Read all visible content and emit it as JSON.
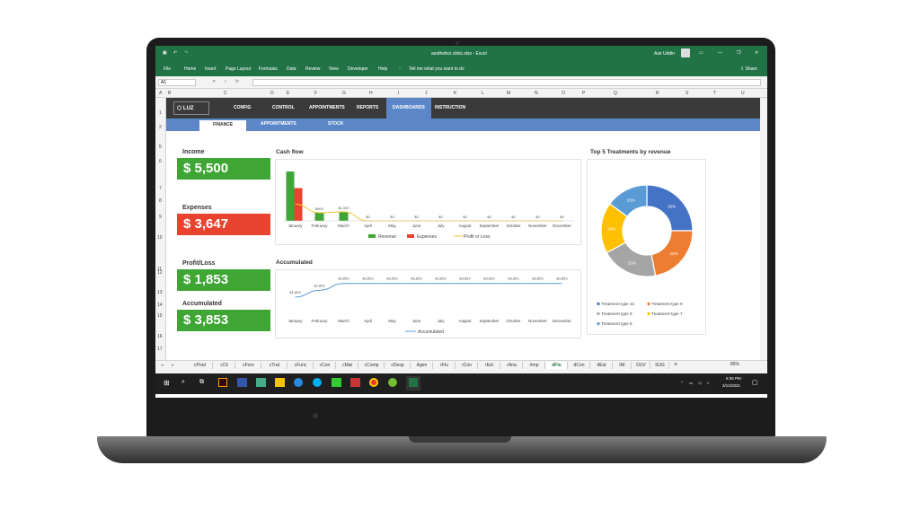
{
  "window": {
    "title": "aesthetics clinic.xlsx - Excel",
    "user": "Asir Uddin"
  },
  "menu": [
    "File",
    "Home",
    "Insert",
    "Page Layout",
    "Formulas",
    "Data",
    "Review",
    "View",
    "Developer",
    "Help"
  ],
  "tell_me": "Tell me what you want to do",
  "share": "Share",
  "name_box": "A1",
  "columns": [
    "A",
    "B",
    "C",
    "D",
    "E",
    "F",
    "G",
    "H",
    "I",
    "J",
    "K",
    "L",
    "M",
    "N",
    "O",
    "P",
    "Q",
    "R",
    "S",
    "T",
    "U"
  ],
  "rows": [
    "1",
    "2",
    "5",
    "6",
    "7",
    "8",
    "9",
    "10",
    "11",
    "12",
    "13",
    "14",
    "15",
    "16",
    "17"
  ],
  "nav": {
    "logo": "LUZ",
    "items": [
      "CONFIG",
      "CONTROL",
      "APPOINTMENTS",
      "REPORTS",
      "DASHBOARDS",
      "INSTRUCTION"
    ]
  },
  "subnav": [
    "FINANCE",
    "APPOINTMENTS",
    "STOCK"
  ],
  "kpis": {
    "income_label": "Income",
    "income": "$ 5,500",
    "expenses_label": "Expenses",
    "expenses": "$ 3,647",
    "profit_label": "Profit/Loss",
    "profit": "$ 1,853",
    "accum_label": "Accumulated",
    "accum": "$ 3,853"
  },
  "chart_data": [
    {
      "type": "bar",
      "title": "Cash flow",
      "categories": [
        "January",
        "February",
        "March",
        "April",
        "May",
        "June",
        "July",
        "August",
        "September",
        "October",
        "November",
        "December"
      ],
      "series": [
        {
          "name": "Revenue",
          "values": [
            5500,
            0,
            0,
            0,
            0,
            0,
            0,
            0,
            0,
            0,
            0,
            0
          ],
          "color": "#3fa535"
        },
        {
          "name": "Expenses",
          "values": [
            3647,
            0,
            0,
            0,
            0,
            0,
            0,
            0,
            0,
            0,
            0,
            0
          ],
          "color": "#e8432e"
        },
        {
          "name": "Profit or Loss",
          "values": [
            1853,
            900,
            1000,
            0,
            0,
            0,
            0,
            0,
            0,
            0,
            0,
            0
          ],
          "color": "#f2c12e"
        }
      ],
      "data_labels": [
        "",
        "$900",
        "$1,000",
        "$0",
        "$0",
        "$0",
        "$0",
        "$0",
        "$0",
        "$0",
        "$0",
        "$0"
      ],
      "ylim": [
        0,
        6000
      ]
    },
    {
      "type": "line",
      "title": "Accumulated",
      "categories": [
        "January",
        "February",
        "March",
        "April",
        "May",
        "June",
        "July",
        "August",
        "September",
        "October",
        "November",
        "December"
      ],
      "series": [
        {
          "name": "Accumulated",
          "values": [
            1853,
            2853,
            3853,
            3853,
            3853,
            3853,
            3853,
            3853,
            3853,
            3853,
            3853,
            3853
          ],
          "color": "#5b9bd5"
        }
      ],
      "data_labels": [
        "$1,853",
        "$2,853",
        "$3,853",
        "$3,853",
        "$3,853",
        "$3,853",
        "$3,853",
        "$3,853",
        "$3,853",
        "$3,853",
        "$3,853",
        "$3,853"
      ],
      "ylim": [
        0,
        5000
      ]
    },
    {
      "type": "pie",
      "title": "Top 5 Treatments by revenue",
      "labels": [
        "Treatment type 10",
        "Treatment type 9",
        "Treatment type 8",
        "Treatment type 7",
        "Treatment type 6"
      ],
      "values": [
        25,
        22,
        20,
        18,
        15
      ],
      "value_labels": [
        "25%",
        "22%",
        "20%",
        "18%",
        "15%"
      ],
      "colors": [
        "#4472c4",
        "#ed7d31",
        "#a5a5a5",
        "#ffc000",
        "#5b9bd5"
      ]
    }
  ],
  "sheet_tabs": [
    "cProd",
    "cCli",
    "cForn",
    "cTrat",
    "cFunc",
    "cCon",
    "cMat",
    "cComp",
    "cDesp",
    "Agen",
    "rFlu",
    "rCon",
    "rEst",
    "rAna",
    "rImp",
    "dFin",
    "dCon",
    "dEst",
    "INI",
    "DUV",
    "SUG"
  ],
  "active_tab": "dFin",
  "zoom": "85%",
  "clock": {
    "time": "5:36 PM",
    "date": "3/12/2021"
  }
}
